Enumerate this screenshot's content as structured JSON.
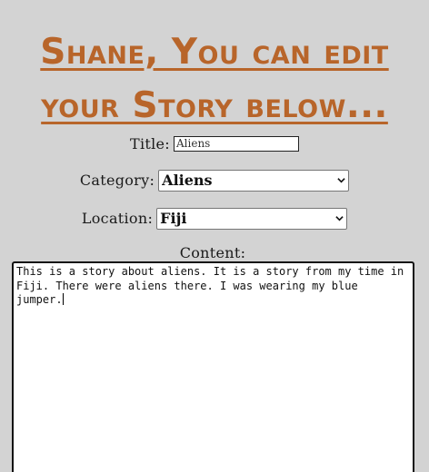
{
  "page": {
    "heading": "Shane, You can edit your Story below...",
    "accent_color": "#b8652a",
    "background_color": "#d3d3d3"
  },
  "form": {
    "title_label": "Title:",
    "title_value": "Aliens",
    "category_label": "Category:",
    "category_selected": "Aliens",
    "location_label": "Location:",
    "location_selected": "Fiji",
    "content_label": "Content:",
    "content_value": "This is a story about aliens. It is a story from my time in Fiji. There were aliens there. I was wearing my blue jumper."
  },
  "icons": {
    "dropdown": "chevron-down-icon"
  }
}
